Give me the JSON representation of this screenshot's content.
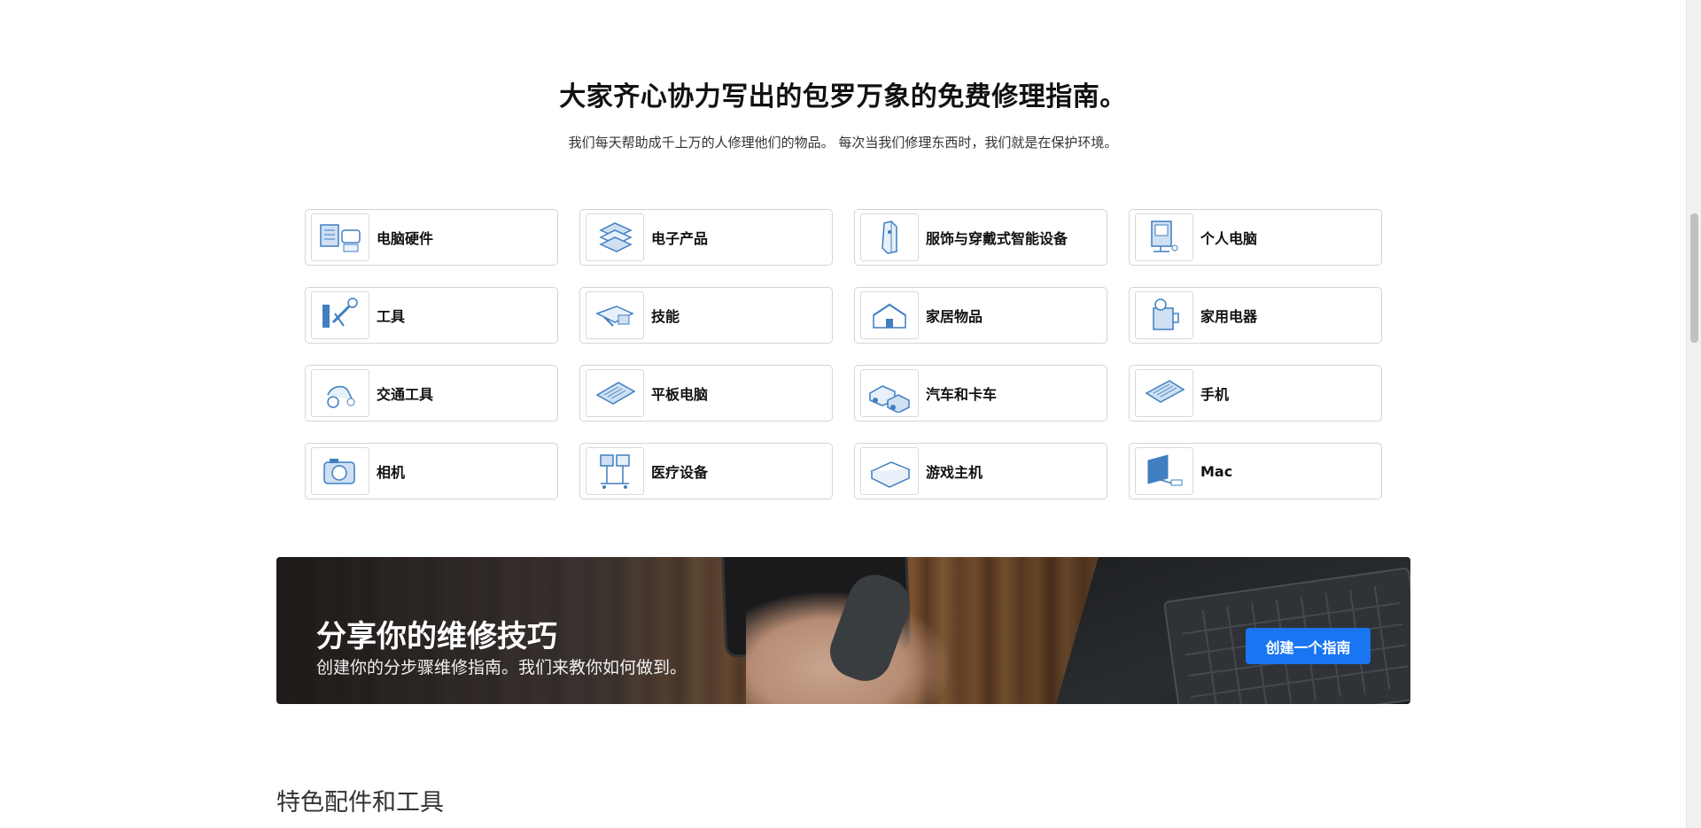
{
  "hero": {
    "title": "大家齐心协力写出的包罗万象的免费修理指南。",
    "subtitle": "我们每天帮助成千上万的人修理他们的物品。 每次当我们修理东西时，我们就是在保护环境。"
  },
  "categories": [
    {
      "label": "电脑硬件",
      "icon": "computer-hardware-icon"
    },
    {
      "label": "电子产品",
      "icon": "electronics-icon"
    },
    {
      "label": "服饰与穿戴式智能设备",
      "icon": "apparel-icon"
    },
    {
      "label": "个人电脑",
      "icon": "pc-icon"
    },
    {
      "label": "工具",
      "icon": "tools-icon"
    },
    {
      "label": "技能",
      "icon": "skills-icon"
    },
    {
      "label": "家居物品",
      "icon": "household-icon"
    },
    {
      "label": "家用电器",
      "icon": "appliance-icon"
    },
    {
      "label": "交通工具",
      "icon": "vehicle-icon"
    },
    {
      "label": "平板电脑",
      "icon": "tablet-icon"
    },
    {
      "label": "汽车和卡车",
      "icon": "car-truck-icon"
    },
    {
      "label": "手机",
      "icon": "phone-icon"
    },
    {
      "label": "相机",
      "icon": "camera-icon"
    },
    {
      "label": "医疗设备",
      "icon": "medical-device-icon"
    },
    {
      "label": "游戏主机",
      "icon": "game-console-icon"
    },
    {
      "label": "Mac",
      "icon": "mac-icon"
    }
  ],
  "banner": {
    "title": "分享你的维修技巧",
    "subtitle": "创建你的分步骤维修指南。我们来教你如何做到。",
    "button_label": "创建一个指南"
  },
  "featured": {
    "title": "特色配件和工具"
  },
  "colors": {
    "accent": "#1975f1",
    "icon_blue": "#3f7fc2"
  }
}
